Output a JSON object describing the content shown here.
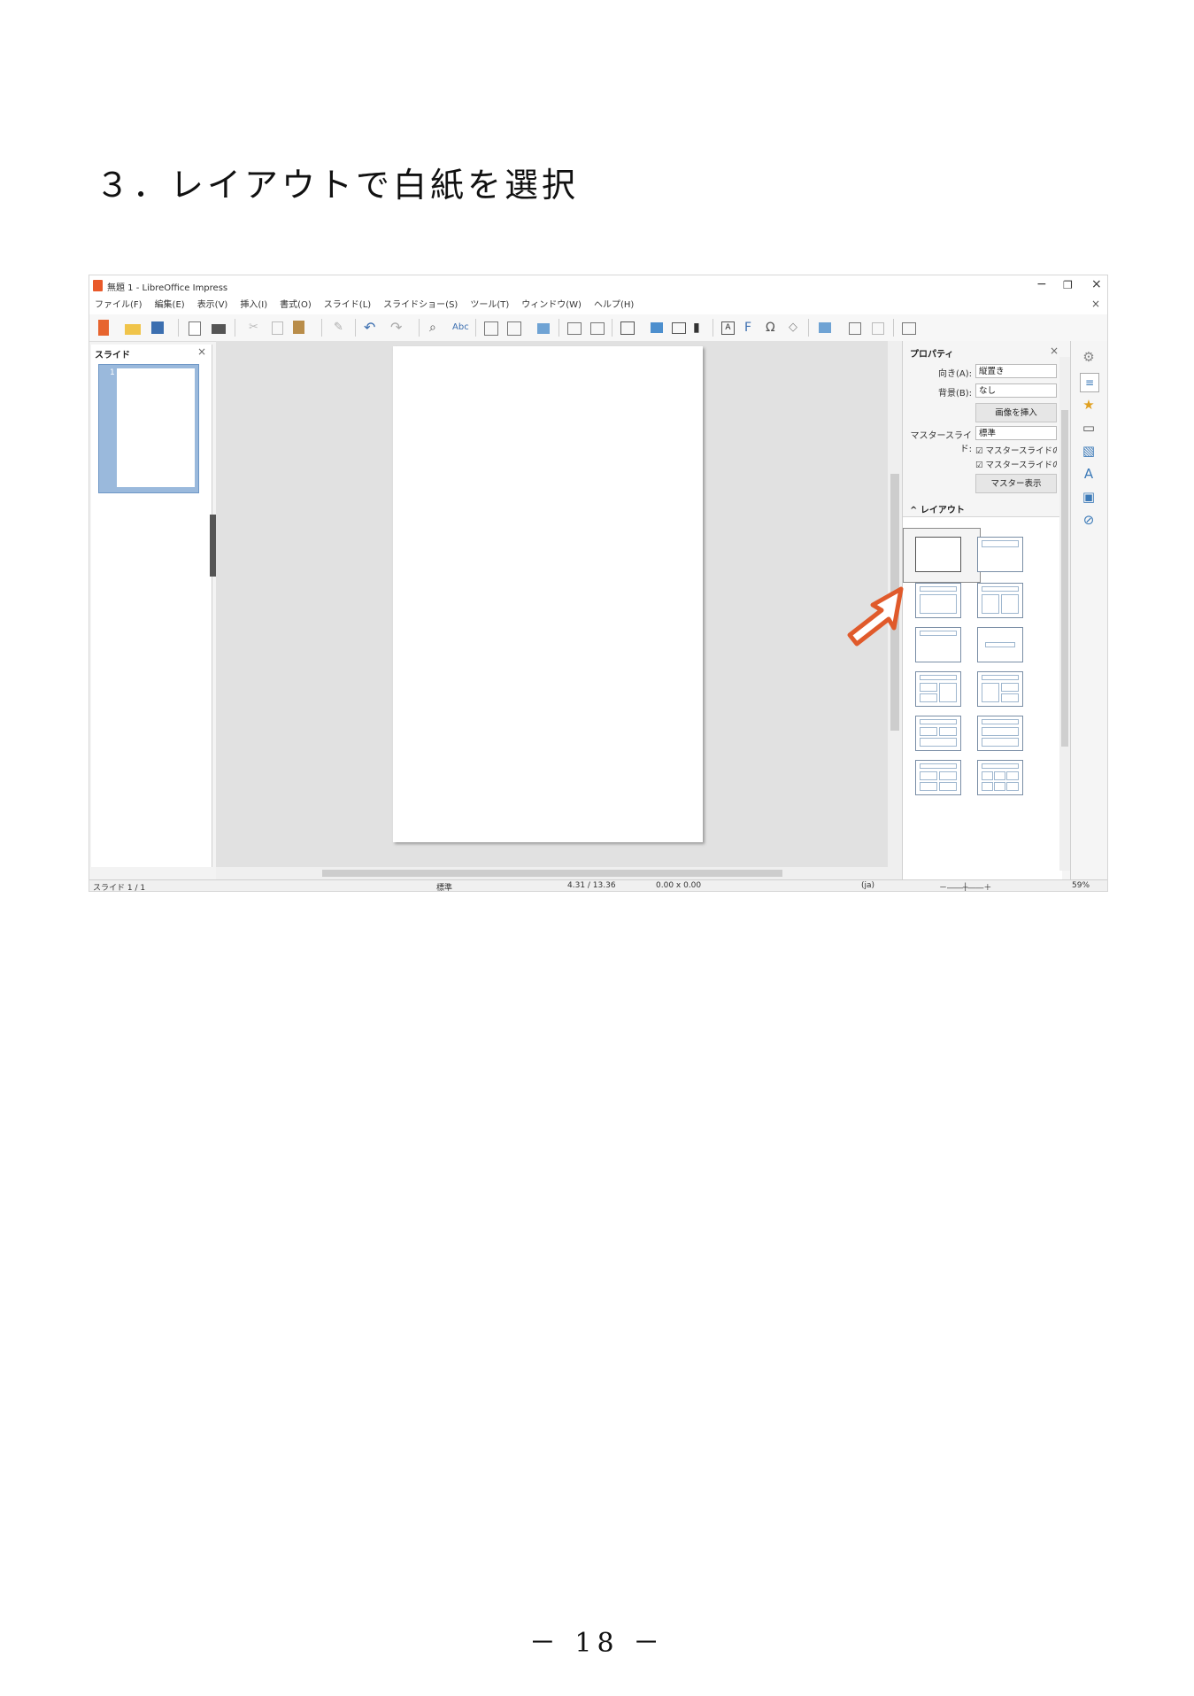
{
  "heading": "３．レイアウトで白紙を選択",
  "page_number": "－ 18 －",
  "window": {
    "title": "無題 1 - LibreOffice Impress",
    "minimize": "−",
    "restore": "❐",
    "close": "×"
  },
  "menu": [
    "ファイル(F)",
    "編集(E)",
    "表示(V)",
    "挿入(I)",
    "書式(O)",
    "スライド(L)",
    "スライドショー(S)",
    "ツール(T)",
    "ウィンドウ(W)",
    "ヘルプ(H)"
  ],
  "slide_pane": {
    "title": "スライド",
    "close": "×",
    "thumb_number": "1"
  },
  "sidebar": {
    "properties_title": "プロパティ",
    "close": "×",
    "orientation_label": "向き(A):",
    "orientation_value": "縦置き",
    "background_label": "背景(B):",
    "background_value": "なし",
    "insert_image_button": "画像を挿入",
    "master_slide_label": "マスタースライド:",
    "master_slide_value": "標準",
    "check1": "☑ マスタースライドの背景",
    "check2": "☑ マスタースライドのオブジェクト",
    "master_view_button": "マスター表示",
    "layout_title": "^ レイアウト"
  },
  "statusbar": {
    "slide": "スライド 1 / 1",
    "master": "標準",
    "position": "4.31 / 13.36",
    "size": "0.00 x 0.00",
    "language": "(ja)",
    "zoom": "59%"
  },
  "colors": {
    "arrow": "#e05a2b",
    "accent": "#3c7ab8"
  }
}
